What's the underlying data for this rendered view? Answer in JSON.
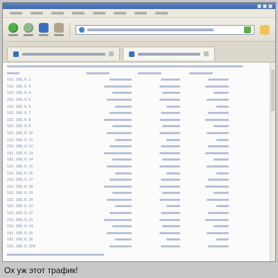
{
  "capture": {
    "rows": [
      {
        "ip": "192.168.0.2"
      },
      {
        "ip": "192.168.0.3"
      },
      {
        "ip": "192.168.0.4"
      },
      {
        "ip": "192.168.0.5"
      },
      {
        "ip": "192.168.0.6"
      },
      {
        "ip": "192.168.0.7"
      },
      {
        "ip": "192.168.0.8"
      },
      {
        "ip": "192.168.0.9"
      },
      {
        "ip": "192.168.0.10"
      },
      {
        "ip": "192.168.0.11"
      },
      {
        "ip": "192.168.0.12"
      },
      {
        "ip": "192.168.0.13"
      },
      {
        "ip": "192.168.0.14"
      },
      {
        "ip": "192.168.0.15"
      },
      {
        "ip": "192.168.0.16"
      },
      {
        "ip": "192.168.0.17"
      },
      {
        "ip": "192.168.0.18"
      },
      {
        "ip": "192.168.0.19"
      },
      {
        "ip": "192.168.0.20"
      },
      {
        "ip": "192.168.0.21"
      },
      {
        "ip": "192.168.0.22"
      },
      {
        "ip": "192.168.0.23"
      },
      {
        "ip": "192.168.0.24"
      },
      {
        "ip": "192.168.0.25"
      },
      {
        "ip": "192.168.0.26"
      },
      {
        "ip": "192.168.0.254"
      }
    ]
  },
  "caption": "Ох уж этот трафик!"
}
